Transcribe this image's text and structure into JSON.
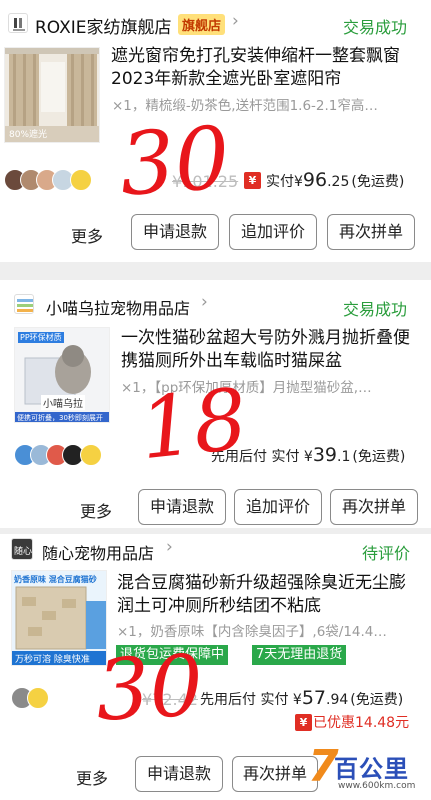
{
  "orders": [
    {
      "shop_name": "ROXIE家纺旗舰店",
      "shop_flag": "旗舰店",
      "status": "交易成功",
      "title": "遮光窗帘免打孔安装伸缩杆一整套飘窗2023年新款全遮光卧室遮阳帘",
      "spec": "×1，精梳缎-奶茶色,送杆范围1.6-2.1窄高…",
      "thumb_caption": "80%遮光",
      "original_price": "¥101.25",
      "paid_label": "实付",
      "price_symbol": "¥",
      "price_int": "96",
      "price_dec": ".25",
      "shipping": "(免运费)",
      "more": "更多",
      "buttons": [
        "申请退款",
        "追加评价",
        "再次拼单"
      ],
      "handwritten": "30"
    },
    {
      "shop_name": "小喵乌拉宠物用品店",
      "status": "交易成功",
      "title": "一次性猫砂盆超大号防外溅月抛折叠便携猫厕所外出车载临时猫屎盆",
      "spec": "×1，【pp环保加厚材质】月抛型猫砂盆,…",
      "thumb_tag": "PP环保材质",
      "thumb_brand": "小喵乌拉",
      "thumb_footer": "便携可折叠，30秒即刻展开",
      "pay_later": "先用后付",
      "paid_label": "实付",
      "price_symbol": "¥",
      "price_int": "39",
      "price_dec": ".1",
      "shipping": "(免运费)",
      "more": "更多",
      "buttons": [
        "申请退款",
        "追加评价",
        "再次拼单"
      ],
      "handwritten": "18"
    },
    {
      "shop_name": "随心宠物用品店",
      "status": "待评价",
      "title": "混合豆腐猫砂新升级超强除臭近无尘膨润土可冲厕所秒结团不粘底",
      "spec": "×1，奶香原味【内含除臭因子】,6袋/14.4…",
      "thumb_header": "奶香原味 混合豆腐猫砂",
      "thumb_footer": "万秒可溶 除臭快准",
      "tags": [
        "退货包运费保障中",
        "7天无理由退货"
      ],
      "original_price": "¥72.42",
      "pay_later": "先用后付",
      "paid_label": "实付",
      "price_symbol": "¥",
      "price_int": "57",
      "price_dec": ".94",
      "shipping": "(免运费)",
      "discount": "已优惠14.48元",
      "more": "更多",
      "buttons": [
        "申请退款",
        "再次拼单"
      ],
      "handwritten": "30"
    }
  ],
  "watermark": {
    "brand": "百公里",
    "url": "www.600km.com"
  },
  "colors": {
    "status_green": "#2a9d3c",
    "price_red": "#e02e24",
    "tag_green": "#2aa84a",
    "handwriting_red": "#e8161b",
    "flag_yellow": "#ffe07a"
  }
}
